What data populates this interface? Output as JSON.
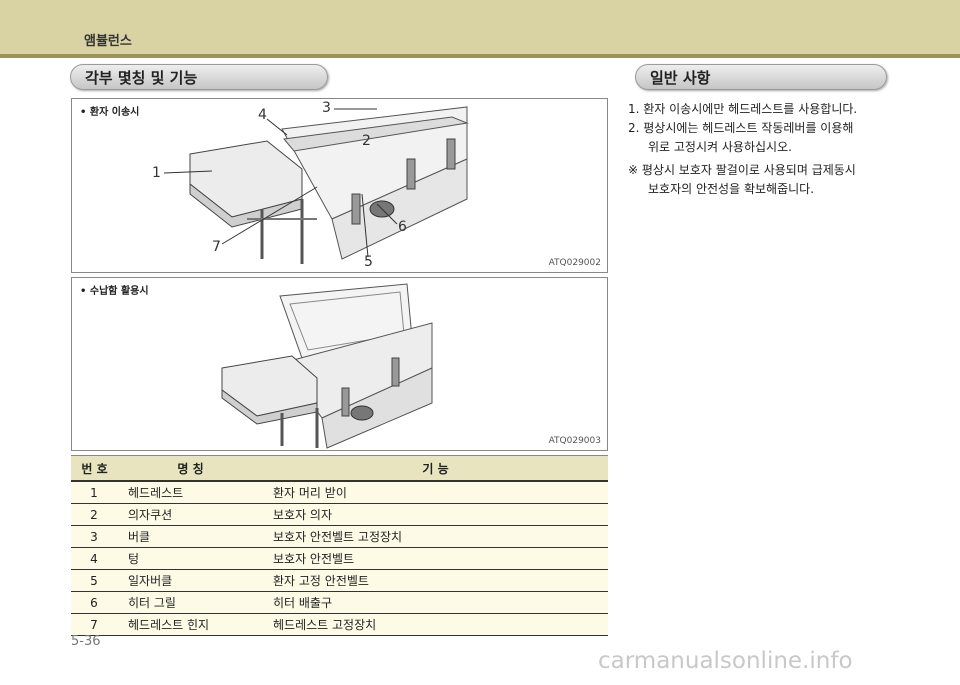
{
  "header": {
    "section_title": "앰뷸런스"
  },
  "left_heading": "각부 몇칭 및 기능",
  "right_heading": "일반 사항",
  "figure1": {
    "label": "환자 이송시",
    "code": "ATQ029002",
    "callouts": [
      "1",
      "2",
      "3",
      "4",
      "5",
      "6",
      "7"
    ]
  },
  "figure2": {
    "label": "수납함 활용시",
    "code": "ATQ029003"
  },
  "table": {
    "headers": [
      "번 호",
      "명    칭",
      "기      능"
    ],
    "rows": [
      [
        "1",
        "헤드레스트",
        "환자 머리 받이"
      ],
      [
        "2",
        "의자쿠션",
        "보호자 의자"
      ],
      [
        "3",
        "버클",
        "보호자 안전벨트 고정장치"
      ],
      [
        "4",
        "텅",
        "보호자 안전벨트"
      ],
      [
        "5",
        "일자버클",
        "환자 고정 안전벨트"
      ],
      [
        "6",
        "히터 그릴",
        "히터 배출구"
      ],
      [
        "7",
        "헤드레스트 힌지",
        "헤드레스트 고정장치"
      ]
    ]
  },
  "notes": {
    "line1": "1.  환자 이송시에만 헤드레스트를 사용합니다.",
    "line2a": "2.  평상시에는 헤드레스트 작동레버를 이용해",
    "line2b": "위로 고정시켜 사용하십시오.",
    "line3a": "※  평상시 보호자 팔걸이로 사용되며 급제동시",
    "line3b": "보호자의 안전성을 확보해줍니다."
  },
  "page_number": "5-36",
  "watermark": "carmanualsonline.info"
}
